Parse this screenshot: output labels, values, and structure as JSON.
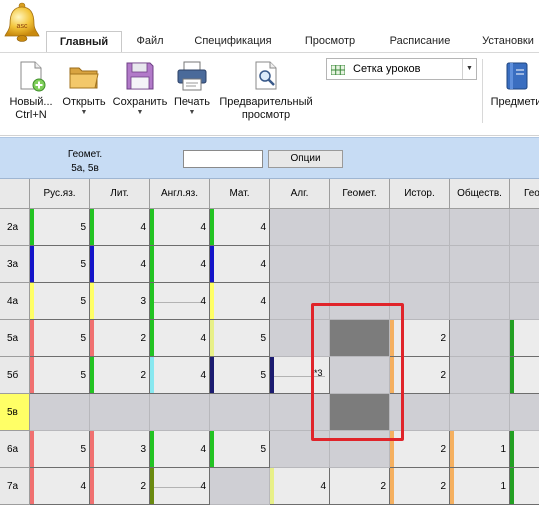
{
  "app_button": {
    "icon": "bell-icon",
    "badge": "asc"
  },
  "tabs": [
    {
      "label": "Главный",
      "active": true
    },
    {
      "label": "Файл",
      "active": false
    },
    {
      "label": "Спецификация",
      "active": false
    },
    {
      "label": "Просмотр",
      "active": false
    },
    {
      "label": "Расписание",
      "active": false
    },
    {
      "label": "Установки",
      "active": false
    }
  ],
  "ribbon": {
    "new": {
      "label": "Новый...",
      "shortcut": "Ctrl+N",
      "icon": "new-document-icon"
    },
    "open": {
      "label": "Открыть",
      "icon": "folder-icon"
    },
    "save": {
      "label": "Сохранить",
      "icon": "floppy-disk-icon"
    },
    "print": {
      "label": "Печать",
      "icon": "printer-icon"
    },
    "preview": {
      "label_line1": "Предварительный",
      "label_line2": "просмотр",
      "icon": "print-preview-icon"
    },
    "view_select": {
      "value": "Сетка уроков",
      "icon": "grid-icon"
    },
    "subjects": {
      "label": "Предмети",
      "icon": "book-icon"
    }
  },
  "filter": {
    "label_line1": "Геомет.",
    "label_line2": "5а, 5в",
    "input_value": "",
    "options_label": "Опции"
  },
  "grid": {
    "columns": [
      "Рус.яз.",
      "Лит.",
      "Англ.яз.",
      "Мат.",
      "Алг.",
      "Геомет.",
      "Истор.",
      "Обществ.",
      "Гео"
    ],
    "rows": [
      {
        "label": "2а",
        "highlight": false,
        "cells": [
          {
            "v": "5",
            "c": "#22c322"
          },
          {
            "v": "4",
            "c": "#22c322"
          },
          {
            "v": "4",
            "c": "#22c322"
          },
          {
            "v": "4",
            "c": "#22c322"
          },
          null,
          null,
          null,
          null,
          null
        ]
      },
      {
        "label": "3а",
        "highlight": false,
        "cells": [
          {
            "v": "5",
            "c": "#1414c8"
          },
          {
            "v": "4",
            "c": "#1414c8"
          },
          {
            "v": "4",
            "c": "#22c322"
          },
          {
            "v": "4",
            "c": "#1414c8"
          },
          null,
          null,
          null,
          null,
          null
        ]
      },
      {
        "label": "4а",
        "highlight": false,
        "cells": [
          {
            "v": "5",
            "c": "#ffff66"
          },
          {
            "v": "3",
            "c": "#ffff66"
          },
          {
            "v": "4",
            "c": "#22c322",
            "line": true
          },
          {
            "v": "4",
            "c": "#ffff66"
          },
          null,
          null,
          null,
          null,
          null
        ]
      },
      {
        "label": "5а",
        "highlight": false,
        "cells": [
          {
            "v": "5",
            "c": "#f07070"
          },
          {
            "v": "2",
            "c": "#f07070"
          },
          {
            "v": "4",
            "c": "#22c322"
          },
          {
            "v": "5",
            "c": "#e8f088"
          },
          null,
          {
            "dark": true
          },
          {
            "v": "2",
            "c": "#f5b060"
          },
          null,
          {
            "v": "",
            "c": "#22a022"
          }
        ]
      },
      {
        "label": "5б",
        "highlight": false,
        "cells": [
          {
            "v": "5",
            "c": "#f07070"
          },
          {
            "v": "2",
            "c": "#22c322"
          },
          {
            "v": "4",
            "c": "#88e8f0"
          },
          {
            "v": "5",
            "c": "#1c1c70"
          },
          {
            "v": "",
            "c": "#1c1c70",
            "line": true,
            "note": "*3"
          },
          null,
          {
            "v": "2",
            "c": "#f5b060"
          },
          null,
          {
            "v": "",
            "c": "#22a022"
          }
        ]
      },
      {
        "label": "5в",
        "highlight": true,
        "cells": [
          null,
          null,
          null,
          null,
          null,
          {
            "dark": true
          },
          null,
          null,
          null
        ]
      },
      {
        "label": "6а",
        "highlight": false,
        "cells": [
          {
            "v": "5",
            "c": "#f07070"
          },
          {
            "v": "3",
            "c": "#f07070"
          },
          {
            "v": "4",
            "c": "#22c322"
          },
          {
            "v": "5",
            "c": "#22c322"
          },
          null,
          null,
          {
            "v": "2",
            "c": "#f5b060"
          },
          {
            "v": "1",
            "c": "#f5b060"
          },
          {
            "v": "",
            "c": "#22a022"
          }
        ]
      },
      {
        "label": "7а",
        "highlight": false,
        "cells": [
          {
            "v": "4",
            "c": "#f07070"
          },
          {
            "v": "2",
            "c": "#f07070"
          },
          {
            "v": "4",
            "c": "#6a8a10",
            "line": true
          },
          null,
          {
            "v": "4",
            "c": "#e8f088"
          },
          {
            "v": "2",
            "c": ""
          },
          {
            "v": "2",
            "c": "#f5b060"
          },
          {
            "v": "1",
            "c": "#f5b060"
          },
          {
            "v": "",
            "c": "#22a022"
          }
        ]
      }
    ]
  }
}
